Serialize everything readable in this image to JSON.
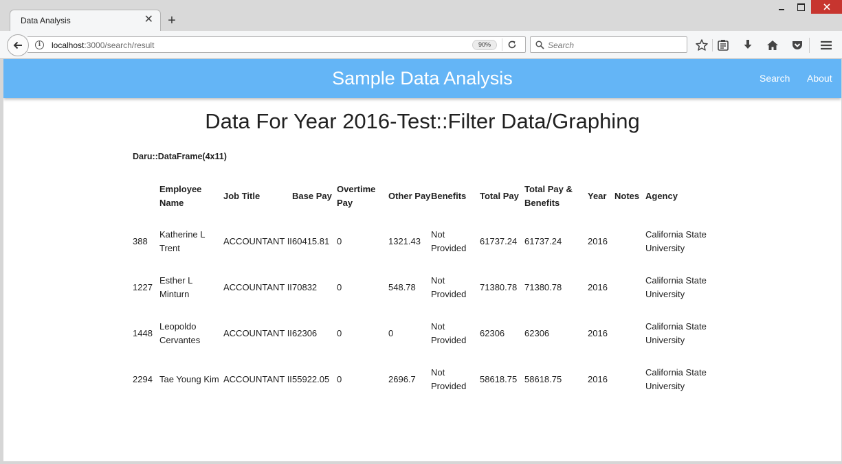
{
  "browser": {
    "tab_title": "Data Analysis",
    "new_tab": "+",
    "url_host": "localhost",
    "url_path": ":3000/search/result",
    "zoom": "90%",
    "search_placeholder": "Search"
  },
  "app": {
    "brand": "Sample Data Analysis",
    "nav": {
      "search": "Search",
      "about": "About"
    }
  },
  "page": {
    "title": "Data For Year 2016-Test::Filter Data/Graphing",
    "dataframe_label": "Daru::DataFrame(4x11)"
  },
  "table": {
    "headers": [
      "",
      "Employee Name",
      "Job Title",
      "Base Pay",
      "Overtime Pay",
      "Other Pay",
      "Benefits",
      "Total Pay",
      "Total Pay & Benefits",
      "Year",
      "Notes",
      "Agency"
    ],
    "rows": [
      [
        "388",
        "Katherine L Trent",
        "ACCOUNTANT II",
        "60415.81",
        "0",
        "1321.43",
        "Not Provided",
        "61737.24",
        "61737.24",
        "2016",
        "",
        "California State University"
      ],
      [
        "1227",
        "Esther L Minturn",
        "ACCOUNTANT II",
        "70832",
        "0",
        "548.78",
        "Not Provided",
        "71380.78",
        "71380.78",
        "2016",
        "",
        "California State University"
      ],
      [
        "1448",
        "Leopoldo Cervantes",
        "ACCOUNTANT II",
        "62306",
        "0",
        "0",
        "Not Provided",
        "62306",
        "62306",
        "2016",
        "",
        "California State University"
      ],
      [
        "2294",
        "Tae Young Kim",
        "ACCOUNTANT II",
        "55922.05",
        "0",
        "2696.7",
        "Not Provided",
        "58618.75",
        "58618.75",
        "2016",
        "",
        "California State University"
      ]
    ]
  }
}
